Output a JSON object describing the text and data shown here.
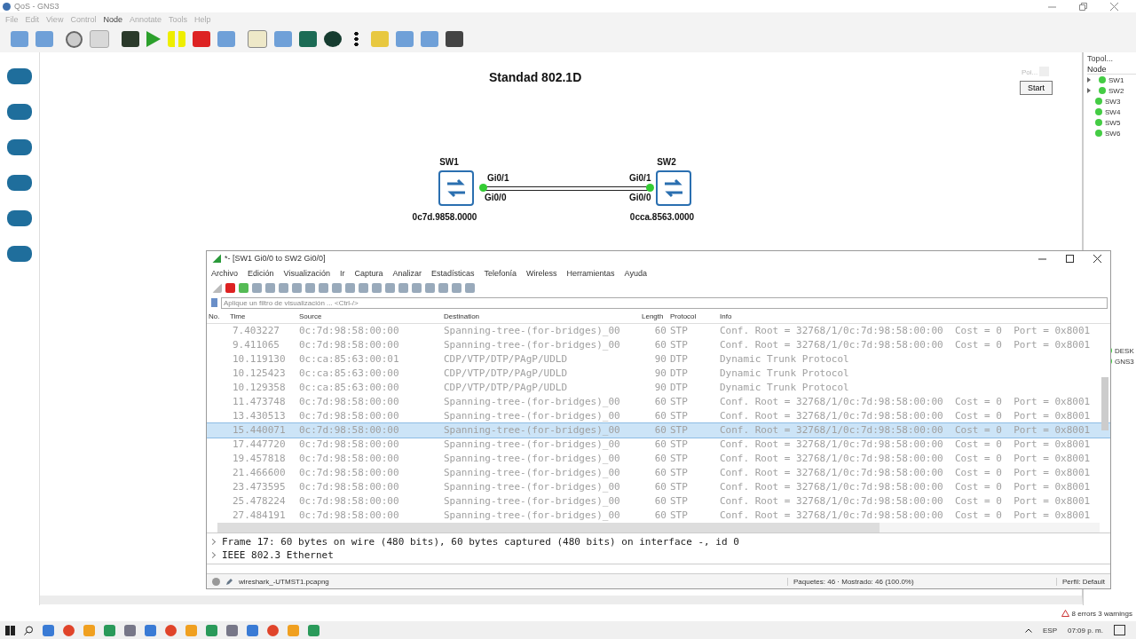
{
  "window": {
    "title": "QoS - GNS3"
  },
  "menu": [
    {
      "label": "File",
      "disabled": true
    },
    {
      "label": "Edit",
      "disabled": true
    },
    {
      "label": "View",
      "disabled": true
    },
    {
      "label": "Control",
      "disabled": true
    },
    {
      "label": "Node",
      "disabled": false
    },
    {
      "label": "Annotate",
      "disabled": true
    },
    {
      "label": "Tools",
      "disabled": true
    },
    {
      "label": "Help",
      "disabled": true
    }
  ],
  "canvas": {
    "title": "Standad 802.1D",
    "poi_label": "Poi...",
    "poi_checked": false,
    "start_button": "Start",
    "nodes": [
      {
        "name": "SW1",
        "address": "0c7d.9858.0000",
        "port_top": "Gi0/1",
        "port_bottom": "Gi0/0"
      },
      {
        "name": "SW2",
        "address": "0cca.8563.0000",
        "port_top": "Gi0/1",
        "port_bottom": "Gi0/0"
      }
    ]
  },
  "topology": {
    "title": "Topol...",
    "header": "Node",
    "items": [
      {
        "label": "SW1",
        "expandable": true
      },
      {
        "label": "SW2",
        "expandable": true
      },
      {
        "label": "SW3",
        "expandable": false
      },
      {
        "label": "SW4",
        "expandable": false
      },
      {
        "label": "SW5",
        "expandable": false
      },
      {
        "label": "SW6",
        "expandable": false
      }
    ]
  },
  "servers": {
    "items": [
      "DESK",
      "GNS3"
    ]
  },
  "wireshark": {
    "title": "*- [SW1 Gi0/0 to SW2 Gi0/0]",
    "menu": [
      "Archivo",
      "Edición",
      "Visualización",
      "Ir",
      "Captura",
      "Analizar",
      "Estadísticas",
      "Telefonía",
      "Wireless",
      "Herramientas",
      "Ayuda"
    ],
    "filter": {
      "placeholder": "Aplique un filtro de visualización ... <Ctrl-/>"
    },
    "columns": [
      "No.",
      "Time",
      "Source",
      "Destination",
      "Length",
      "Protocol",
      "Info"
    ],
    "rows": [
      {
        "time": "7.403227",
        "source": "0c:7d:98:58:00:00",
        "destination": "Spanning-tree-(for-bridges)_00",
        "length": "60",
        "protocol": "STP",
        "info": "Conf. Root = 32768/1/0c:7d:98:58:00:00  Cost = 0  Port = 0x8001",
        "selected": false
      },
      {
        "time": "9.411065",
        "source": "0c:7d:98:58:00:00",
        "destination": "Spanning-tree-(for-bridges)_00",
        "length": "60",
        "protocol": "STP",
        "info": "Conf. Root = 32768/1/0c:7d:98:58:00:00  Cost = 0  Port = 0x8001",
        "selected": false
      },
      {
        "time": "10.119130",
        "source": "0c:ca:85:63:00:01",
        "destination": "CDP/VTP/DTP/PAgP/UDLD",
        "length": "90",
        "protocol": "DTP",
        "info": "Dynamic Trunk Protocol",
        "selected": false
      },
      {
        "time": "10.125423",
        "source": "0c:ca:85:63:00:00",
        "destination": "CDP/VTP/DTP/PAgP/UDLD",
        "length": "90",
        "protocol": "DTP",
        "info": "Dynamic Trunk Protocol",
        "selected": false
      },
      {
        "time": "10.129358",
        "source": "0c:ca:85:63:00:00",
        "destination": "CDP/VTP/DTP/PAgP/UDLD",
        "length": "90",
        "protocol": "DTP",
        "info": "Dynamic Trunk Protocol",
        "selected": false
      },
      {
        "time": "11.473748",
        "source": "0c:7d:98:58:00:00",
        "destination": "Spanning-tree-(for-bridges)_00",
        "length": "60",
        "protocol": "STP",
        "info": "Conf. Root = 32768/1/0c:7d:98:58:00:00  Cost = 0  Port = 0x8001",
        "selected": false
      },
      {
        "time": "13.430513",
        "source": "0c:7d:98:58:00:00",
        "destination": "Spanning-tree-(for-bridges)_00",
        "length": "60",
        "protocol": "STP",
        "info": "Conf. Root = 32768/1/0c:7d:98:58:00:00  Cost = 0  Port = 0x8001",
        "selected": false
      },
      {
        "time": "15.440071",
        "source": "0c:7d:98:58:00:00",
        "destination": "Spanning-tree-(for-bridges)_00",
        "length": "60",
        "protocol": "STP",
        "info": "Conf. Root = 32768/1/0c:7d:98:58:00:00  Cost = 0  Port = 0x8001",
        "selected": true
      },
      {
        "time": "17.447720",
        "source": "0c:7d:98:58:00:00",
        "destination": "Spanning-tree-(for-bridges)_00",
        "length": "60",
        "protocol": "STP",
        "info": "Conf. Root = 32768/1/0c:7d:98:58:00:00  Cost = 0  Port = 0x8001",
        "selected": false
      },
      {
        "time": "19.457818",
        "source": "0c:7d:98:58:00:00",
        "destination": "Spanning-tree-(for-bridges)_00",
        "length": "60",
        "protocol": "STP",
        "info": "Conf. Root = 32768/1/0c:7d:98:58:00:00  Cost = 0  Port = 0x8001",
        "selected": false
      },
      {
        "time": "21.466600",
        "source": "0c:7d:98:58:00:00",
        "destination": "Spanning-tree-(for-bridges)_00",
        "length": "60",
        "protocol": "STP",
        "info": "Conf. Root = 32768/1/0c:7d:98:58:00:00  Cost = 0  Port = 0x8001",
        "selected": false
      },
      {
        "time": "23.473595",
        "source": "0c:7d:98:58:00:00",
        "destination": "Spanning-tree-(for-bridges)_00",
        "length": "60",
        "protocol": "STP",
        "info": "Conf. Root = 32768/1/0c:7d:98:58:00:00  Cost = 0  Port = 0x8001",
        "selected": false
      },
      {
        "time": "25.478224",
        "source": "0c:7d:98:58:00:00",
        "destination": "Spanning-tree-(for-bridges)_00",
        "length": "60",
        "protocol": "STP",
        "info": "Conf. Root = 32768/1/0c:7d:98:58:00:00  Cost = 0  Port = 0x8001",
        "selected": false
      },
      {
        "time": "27.484191",
        "source": "0c:7d:98:58:00:00",
        "destination": "Spanning-tree-(for-bridges)_00",
        "length": "60",
        "protocol": "STP",
        "info": "Conf. Root = 32768/1/0c:7d:98:58:00:00  Cost = 0  Port = 0x8001",
        "selected": false
      }
    ],
    "details": [
      {
        "label": "Frame 17: 60 bytes on wire (480 bits), 60 bytes captured (480 bits) on interface -, id 0",
        "expanded": false
      },
      {
        "label": "IEEE 802.3 Ethernet",
        "expanded": false
      }
    ],
    "status": {
      "file": "wireshark_-UTMST1.pcapng",
      "packets": "Paquetes: 46 · Mostrado: 46 (100.0%)",
      "profile": "Perfil: Default"
    }
  },
  "status_bar": {
    "warnings": "8 errors 3 warnings"
  },
  "taskbar": {
    "language": "ESP",
    "clock": "07:09 p. m."
  }
}
